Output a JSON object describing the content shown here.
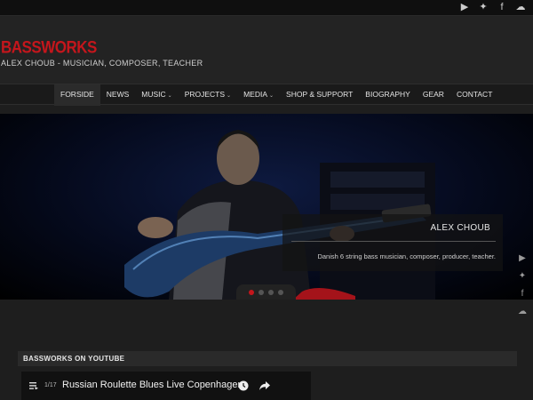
{
  "topbar": {
    "social": [
      {
        "name": "youtube",
        "glyph": "▶"
      },
      {
        "name": "myspace",
        "glyph": "✦"
      },
      {
        "name": "facebook",
        "glyph": "f"
      },
      {
        "name": "soundcloud",
        "glyph": "☁"
      }
    ]
  },
  "header": {
    "site_title": "BASSWORKS",
    "tagline": "ALEX CHOUB - MUSICIAN, COMPOSER, TEACHER",
    "brand_color": "#c4161c"
  },
  "nav": {
    "items": [
      {
        "label": "FORSIDE",
        "active": true,
        "dropdown": false
      },
      {
        "label": "NEWS",
        "active": false,
        "dropdown": false
      },
      {
        "label": "MUSIC",
        "active": false,
        "dropdown": true
      },
      {
        "label": "PROJECTS",
        "active": false,
        "dropdown": true
      },
      {
        "label": "MEDIA",
        "active": false,
        "dropdown": true
      },
      {
        "label": "SHOP & SUPPORT",
        "active": false,
        "dropdown": false
      },
      {
        "label": "BIOGRAPHY",
        "active": false,
        "dropdown": false
      },
      {
        "label": "GEAR",
        "active": false,
        "dropdown": false
      },
      {
        "label": "CONTACT",
        "active": false,
        "dropdown": false
      }
    ]
  },
  "slider": {
    "caption_title": "ALEX CHOUB",
    "caption_text": "Danish 6 string bass musician, composer, producer, teacher.",
    "slides": 4,
    "active_slide": 1
  },
  "side_social": [
    "youtube-icon",
    "myspace-icon",
    "facebook-icon",
    "soundcloud-icon"
  ],
  "youtube_section": {
    "heading": "BASSWORKS ON YOUTUBE",
    "video": {
      "count": "1/17",
      "title": "Russian Roulette Blues Live Copenhagen"
    }
  }
}
